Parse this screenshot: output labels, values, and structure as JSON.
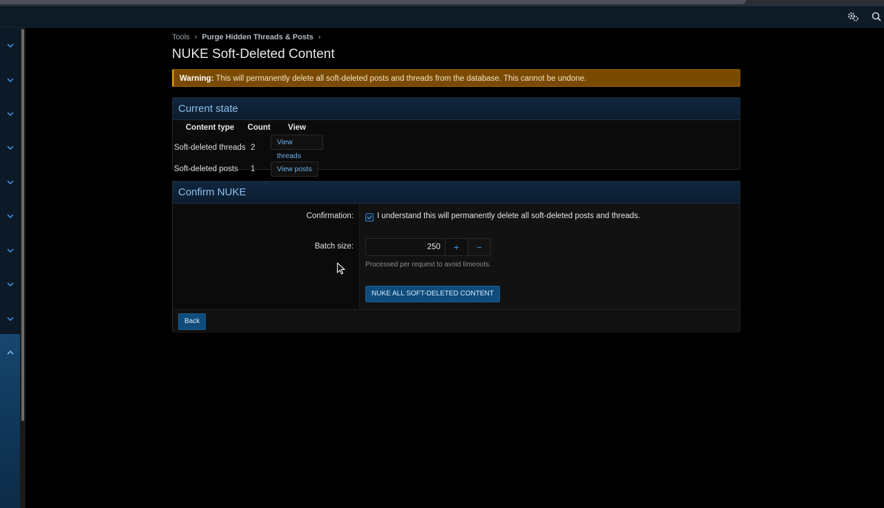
{
  "topbar": {
    "icons": [
      "settings-cogs-icon",
      "search-icon"
    ]
  },
  "sidebar": {
    "chevrons": [
      "chevron-down",
      "chevron-down",
      "chevron-down",
      "chevron-down",
      "chevron-down",
      "chevron-down",
      "chevron-down",
      "chevron-down",
      "chevron-down",
      "chevron-up"
    ]
  },
  "breadcrumb": {
    "items": [
      "Tools",
      "Purge Hidden Threads & Posts"
    ],
    "separator": "›"
  },
  "page": {
    "title": "NUKE Soft-Deleted Content"
  },
  "warning": {
    "label": "Warning:",
    "text": " This will permanently delete all soft-deleted posts and threads from the database. This cannot be undone."
  },
  "current_state": {
    "title": "Current state",
    "headers": [
      "Content type",
      "Count",
      "View"
    ],
    "rows": [
      {
        "type": "Soft-deleted threads",
        "count": "2",
        "view": "View threads"
      },
      {
        "type": "Soft-deleted posts",
        "count": "1",
        "view": "View posts"
      }
    ]
  },
  "confirm": {
    "title": "Confirm NUKE",
    "confirmation_label": "Confirmation:",
    "checkbox_text": "I understand this will permanently delete all soft-deleted posts and threads.",
    "checkbox_checked": true,
    "batch_label": "Batch size:",
    "batch_value": "250",
    "plus": "+",
    "minus": "−",
    "batch_hint": "Processed per request to avoid timeouts.",
    "submit": "NUKE ALL SOFT-DELETED CONTENT",
    "back": "Back"
  },
  "colors": {
    "accent": "#0f4c7c",
    "warning_bg": "#7a4a00",
    "header_text": "#8fc1ea"
  }
}
